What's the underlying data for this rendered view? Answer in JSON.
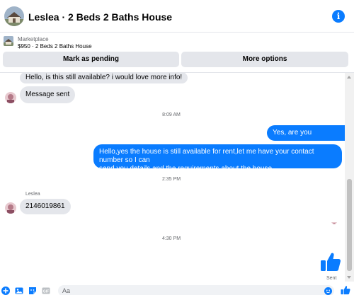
{
  "header": {
    "title": "Leslea · 2 Beds 2 Baths House",
    "info_icon": "info-icon"
  },
  "listing": {
    "source": "Marketplace",
    "summary": "$950 · 2 Beds 2 Baths House",
    "mark_pending_label": "Mark as pending",
    "more_options_label": "More options"
  },
  "messages": {
    "incoming_1": "Hello, is this still available? i would love more info!",
    "incoming_2": "Message sent",
    "time_1": "8:09 AM",
    "outgoing_1": "Yes, are you interested?",
    "outgoing_2_line1": "Hello,yes the house is still available for rent,let me have your contact number so I can",
    "outgoing_2_line2": "send you details and the requirements about the house",
    "time_2": "2:35 PM",
    "sender_name": "Leslea",
    "incoming_3": "2146019861",
    "time_3": "4:30 PM",
    "sent_status": "Sent"
  },
  "composer": {
    "placeholder": "Aa"
  },
  "colors": {
    "accent_blue": "#0a7cff",
    "incoming_bubble": "#e4e6eb",
    "secondary_text": "#65676b"
  }
}
